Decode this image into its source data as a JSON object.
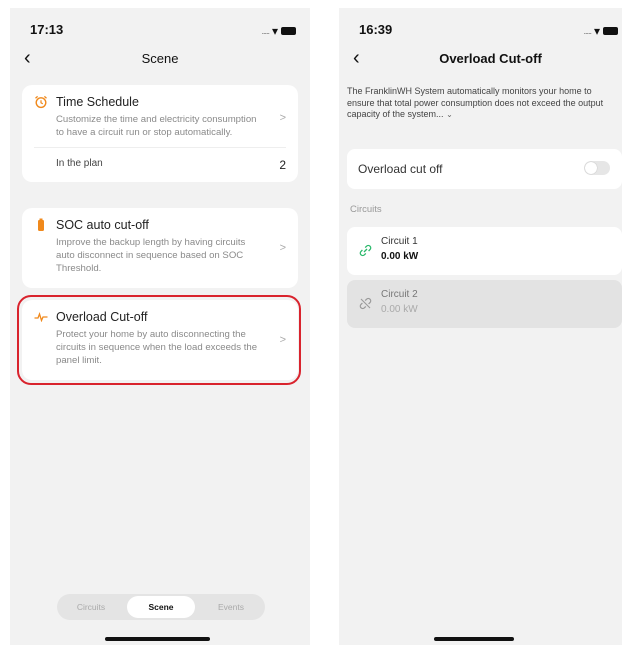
{
  "left_screen": {
    "status_time": "17:13",
    "title": "Scene",
    "cards": [
      {
        "title": "Time Schedule",
        "icon": "alarm-clock-icon",
        "description": "Customize the time and electricity consumption to have a circuit run or stop automatically.",
        "plan_label": "In the plan",
        "plan_count": "2"
      },
      {
        "title": "SOC auto cut-off",
        "icon": "battery-icon",
        "description": "Improve the backup length by having circuits auto disconnect in sequence based on SOC Threshold."
      },
      {
        "title": "Overload Cut-off",
        "icon": "pulse-icon",
        "description": "Protect your home by auto disconnecting the circuits in sequence when the load exceeds the panel limit."
      }
    ],
    "tabs": [
      {
        "label": "Circuits",
        "active": false
      },
      {
        "label": "Scene",
        "active": true
      },
      {
        "label": "Events",
        "active": false
      }
    ]
  },
  "right_screen": {
    "status_time": "16:39",
    "title": "Overload Cut-off",
    "intro": "The FranklinWH System automatically monitors your home to ensure that total power consumption does not exceed the output capacity of the system...",
    "toggle_label": "Overload cut off",
    "toggle_on": false,
    "section_label": "Circuits",
    "circuits": [
      {
        "name": "Circuit  1",
        "power": "0.00 kW",
        "connected": true
      },
      {
        "name": "Circuit  2",
        "power": "0.00 kW",
        "connected": false
      }
    ]
  },
  "colors": {
    "accent_orange": "#f0891c",
    "highlight_red": "#d9232d",
    "connected_green": "#29b86a"
  }
}
